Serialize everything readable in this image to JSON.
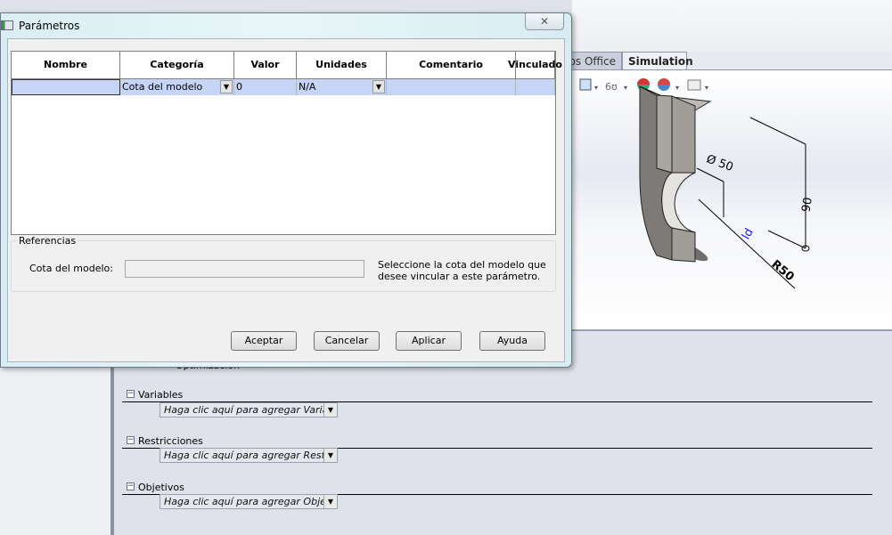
{
  "dialog": {
    "title": "Parámetros",
    "close_icon": "close-x-icon",
    "table": {
      "columns": [
        "Nombre",
        "Categoría",
        "Valor",
        "Unidades",
        "Comentario",
        "Vinculado"
      ],
      "rows": [
        {
          "nombre": "",
          "categoria": "Cota del modelo",
          "valor": "0",
          "unidades": "N/A",
          "comentario": "",
          "vinculado": ""
        }
      ]
    },
    "references": {
      "group_label": "Referencias",
      "field_label": "Cota del modelo:",
      "field_value": "",
      "hint": "Seleccione la cota del modelo que desee vincular a este parámetro."
    },
    "buttons": {
      "ok": "Aceptar",
      "cancel": "Cancelar",
      "apply": "Aplicar",
      "help": "Ayuda"
    }
  },
  "background_app": {
    "tabs": [
      {
        "label": "os Office"
      },
      {
        "label": "Simulation",
        "active": true
      }
    ],
    "viewport": {
      "dimensions": [
        "Ø 50",
        "90",
        "R50"
      ]
    },
    "study": {
      "partial_label": "Optimización",
      "sections": [
        {
          "title": "Variables",
          "placeholder": "Haga clic aquí para agregar Variabl"
        },
        {
          "title": "Restricciones",
          "placeholder": "Haga clic aquí para agregar Restric"
        },
        {
          "title": "Objetivos",
          "placeholder": "Haga clic aquí para agregar Objetiv"
        }
      ]
    }
  },
  "colors": {
    "selected_row": "#c6d4f5",
    "dimension_highlight": "#1a1aff"
  }
}
